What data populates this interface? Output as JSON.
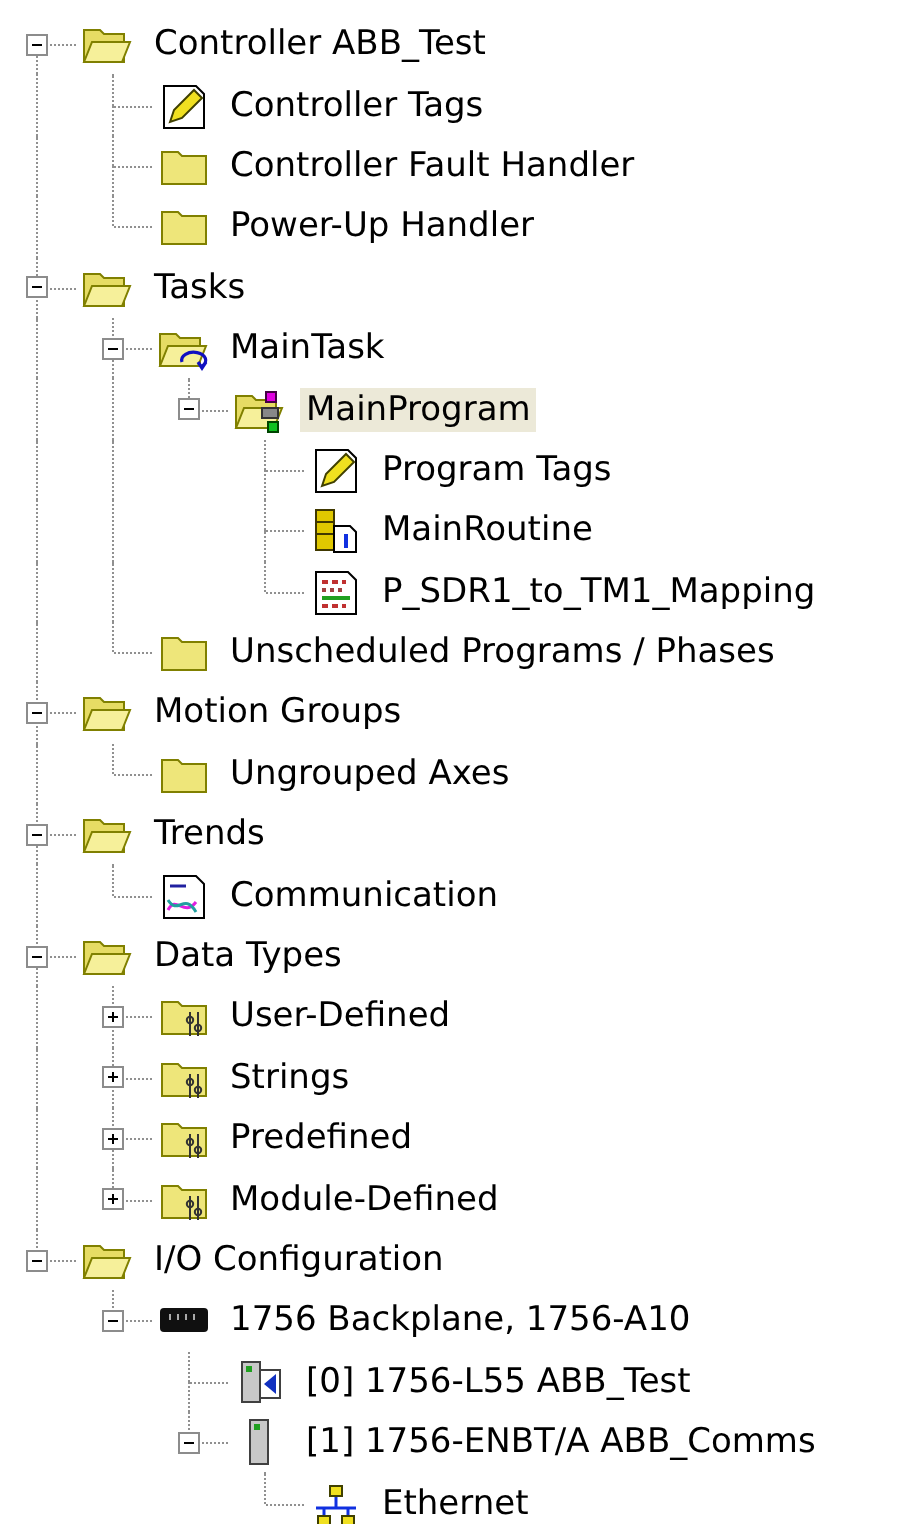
{
  "tree": [
    {
      "label": "Controller ABB_Test",
      "kind": "folder-open",
      "expanded": true,
      "selected": false,
      "children": [
        {
          "label": "Controller Tags",
          "kind": "tags",
          "selected": false
        },
        {
          "label": "Controller Fault Handler",
          "kind": "folder",
          "selected": false
        },
        {
          "label": "Power-Up Handler",
          "kind": "folder",
          "selected": false
        }
      ]
    },
    {
      "label": "Tasks",
      "kind": "folder-open",
      "expanded": true,
      "selected": false,
      "children": [
        {
          "label": "MainTask",
          "kind": "task",
          "expanded": true,
          "selected": false,
          "children": [
            {
              "label": "MainProgram",
              "kind": "program",
              "expanded": true,
              "selected": true,
              "children": [
                {
                  "label": "Program Tags",
                  "kind": "tags",
                  "selected": false
                },
                {
                  "label": "MainRoutine",
                  "kind": "routine",
                  "selected": false
                },
                {
                  "label": "P_SDR1_to_TM1_Mapping",
                  "kind": "mapping",
                  "selected": false
                }
              ]
            }
          ]
        },
        {
          "label": "Unscheduled Programs / Phases",
          "kind": "folder",
          "selected": false
        }
      ]
    },
    {
      "label": "Motion Groups",
      "kind": "folder-open",
      "expanded": true,
      "selected": false,
      "children": [
        {
          "label": "Ungrouped Axes",
          "kind": "folder",
          "selected": false
        }
      ]
    },
    {
      "label": "Trends",
      "kind": "folder-open",
      "expanded": true,
      "selected": false,
      "children": [
        {
          "label": "Communication",
          "kind": "trend",
          "selected": false
        }
      ]
    },
    {
      "label": "Data Types",
      "kind": "folder-open",
      "expanded": true,
      "selected": false,
      "children": [
        {
          "label": "User-Defined",
          "kind": "datatype",
          "expanded": false,
          "selected": false
        },
        {
          "label": "Strings",
          "kind": "datatype",
          "expanded": false,
          "selected": false
        },
        {
          "label": "Predefined",
          "kind": "datatype",
          "expanded": false,
          "selected": false
        },
        {
          "label": "Module-Defined",
          "kind": "datatype",
          "expanded": false,
          "selected": false
        }
      ]
    },
    {
      "label": "I/O Configuration",
      "kind": "folder-open",
      "expanded": true,
      "selected": false,
      "children": [
        {
          "label": "1756 Backplane, 1756-A10",
          "kind": "backplane",
          "expanded": true,
          "selected": false,
          "children": [
            {
              "label": "[0] 1756-L55 ABB_Test",
              "kind": "controller",
              "selected": false
            },
            {
              "label": "[1] 1756-ENBT/A ABB_Comms",
              "kind": "comm",
              "expanded": true,
              "selected": false,
              "children": [
                {
                  "label": "Ethernet",
                  "kind": "network",
                  "selected": false
                }
              ]
            }
          ]
        }
      ]
    }
  ]
}
